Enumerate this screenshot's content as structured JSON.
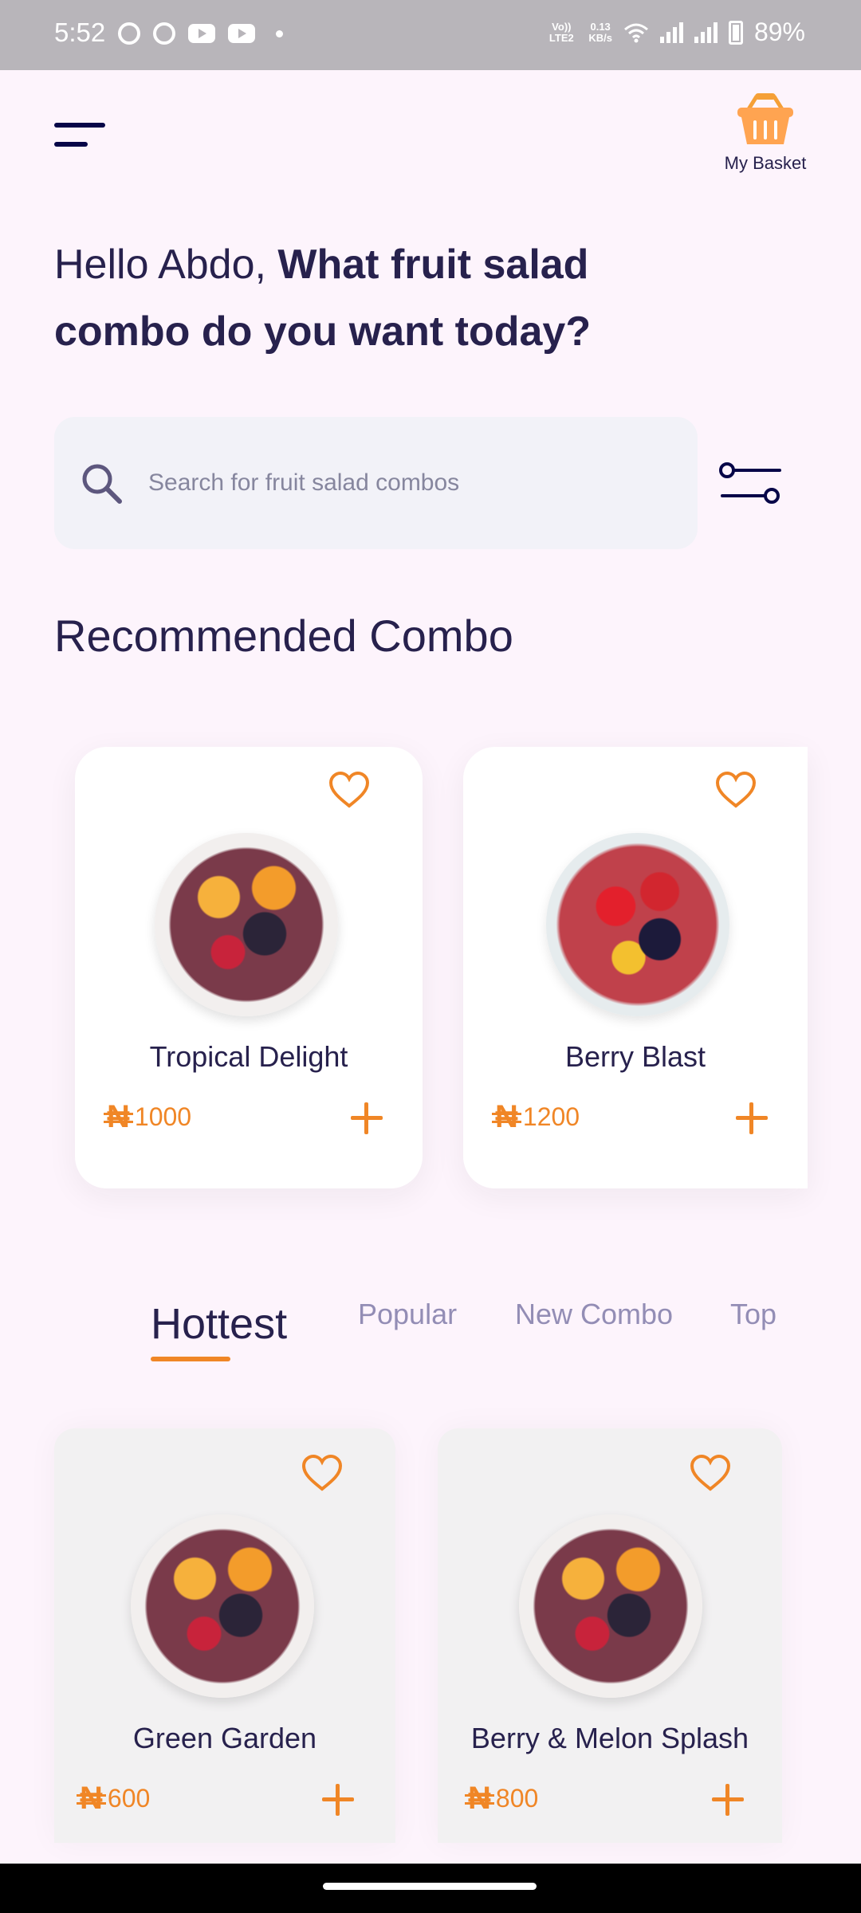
{
  "status": {
    "time": "5:52",
    "volte": "Vo)) LTE2",
    "net_speed_value": "0.13",
    "net_speed_unit": "KB/s",
    "battery": "89%"
  },
  "header": {
    "basket_label": "My Basket"
  },
  "greeting": {
    "hello": "Hello Abdo, ",
    "question": "What fruit salad combo do you want today?"
  },
  "search": {
    "placeholder": "Search for fruit salad combos"
  },
  "recommended": {
    "title": "Recommended Combo",
    "items": [
      {
        "name": "Tropical Delight",
        "currency": "₦",
        "price": "1000"
      },
      {
        "name": "Berry Blast",
        "currency": "₦",
        "price": "1200"
      }
    ]
  },
  "tabs": [
    {
      "label": "Hottest",
      "active": true
    },
    {
      "label": "Popular"
    },
    {
      "label": "New Combo"
    },
    {
      "label": "Top"
    }
  ],
  "hottest": {
    "items": [
      {
        "name": "Green Garden",
        "currency": "₦",
        "price": "600"
      },
      {
        "name": "Berry & Melon Splash",
        "currency": "₦",
        "price": "800"
      }
    ]
  },
  "colors": {
    "accent": "#f08626",
    "text_dark": "#27214d",
    "background": "#fdf4fc"
  },
  "icons": [
    "menu-icon",
    "basket-icon",
    "search-icon",
    "filter-icon",
    "heart-icon",
    "plus-icon"
  ]
}
